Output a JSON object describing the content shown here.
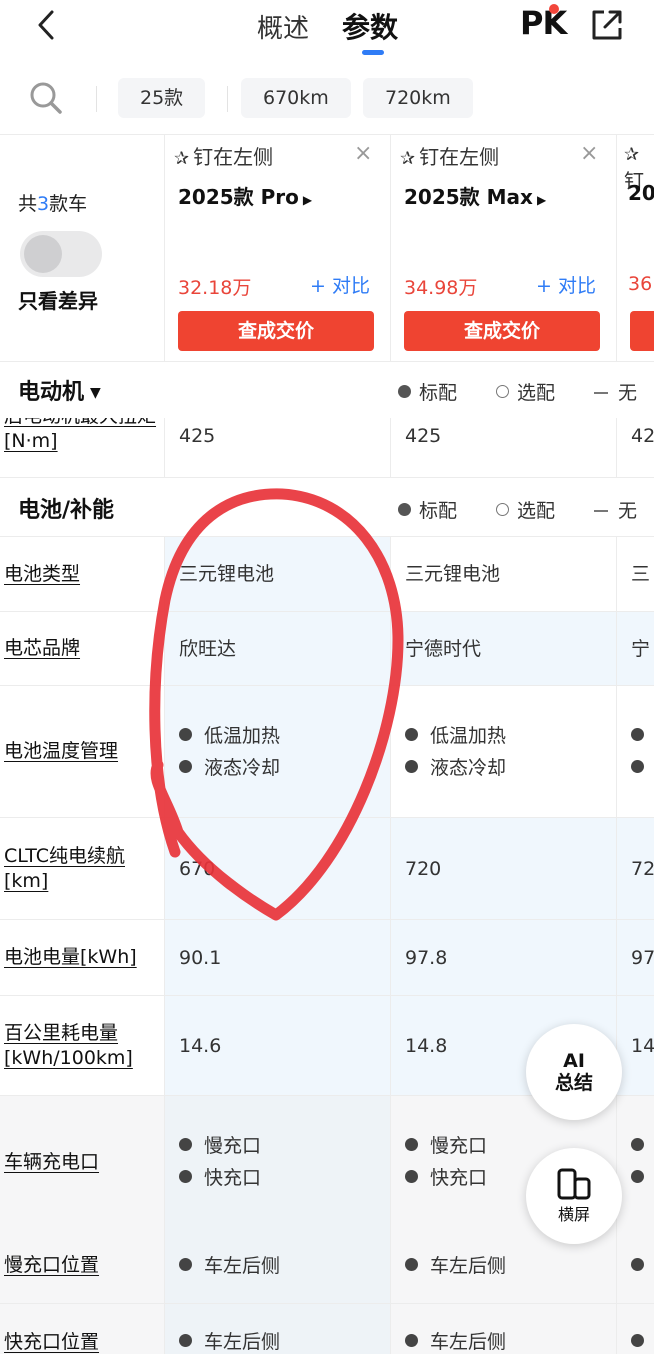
{
  "topbar": {
    "tabs": [
      {
        "label": "概述"
      },
      {
        "label": "参数",
        "active": true
      }
    ],
    "pk_label": "PK"
  },
  "filters": {
    "chips": [
      "25款",
      "670km",
      "720km"
    ]
  },
  "carhead": {
    "count_prefix": "共",
    "count_num": "3",
    "count_suffix": "款车",
    "diff_label": "只看差异",
    "cars": [
      {
        "pin": "钉在左侧",
        "model": "2025款 Pro",
        "price": "32.18万",
        "compare": "+ 对比",
        "deal": "查成交价"
      },
      {
        "pin": "钉在左侧",
        "model": "2025款 Max",
        "price": "34.98万",
        "compare": "+ 对比",
        "deal": "查成交价"
      },
      {
        "pin": "钉",
        "model": "20",
        "price": "36"
      }
    ]
  },
  "legend": {
    "standard": "标配",
    "optional": "选配",
    "none": "无"
  },
  "sections": {
    "motor": {
      "title": "电动机"
    },
    "battery": {
      "title": "电池/补能"
    }
  },
  "motor_rows": [
    {
      "label": "后电动机最大扭矩[N·m]",
      "v1": "425",
      "v2": "425",
      "v3": "42"
    }
  ],
  "battery_rows": [
    {
      "label": "电池类型",
      "v1": "三元锂电池",
      "v2": "三元锂电池",
      "v3": "三"
    },
    {
      "label": "电芯品牌",
      "v1": "欣旺达",
      "v2": "宁德时代",
      "v3": "宁"
    },
    {
      "label": "电池温度管理",
      "v1": [
        "低温加热",
        "液态冷却"
      ],
      "v2": [
        "低温加热",
        "液态冷却"
      ]
    },
    {
      "label": "CLTC纯电续航[km]",
      "v1": "670",
      "v2": "720",
      "v3": "72"
    },
    {
      "label": "电池电量[kWh]",
      "v1": "90.1",
      "v2": "97.8",
      "v3": "97"
    },
    {
      "label": "百公里耗电量[kWh/100km]",
      "v1": "14.6",
      "v2": "14.8",
      "v3": "14"
    },
    {
      "label": "车辆充电口",
      "v1": [
        "慢充口",
        "快充口"
      ],
      "v2": [
        "慢充口",
        "快充口"
      ]
    },
    {
      "label": "慢充口位置",
      "v1": [
        "车左后侧"
      ],
      "v2": [
        "车左后侧"
      ]
    },
    {
      "label": "快充口位置",
      "v1": [
        "车左后侧"
      ],
      "v2": [
        "车左后侧"
      ]
    }
  ],
  "fabs": {
    "ai_line1": "AI",
    "ai_line2": "总结",
    "landscape": "横屏"
  },
  "colors": {
    "accent": "#2f7cf6",
    "price": "#e9453a",
    "button": "#ef4431",
    "annotation": "#e8333a"
  }
}
